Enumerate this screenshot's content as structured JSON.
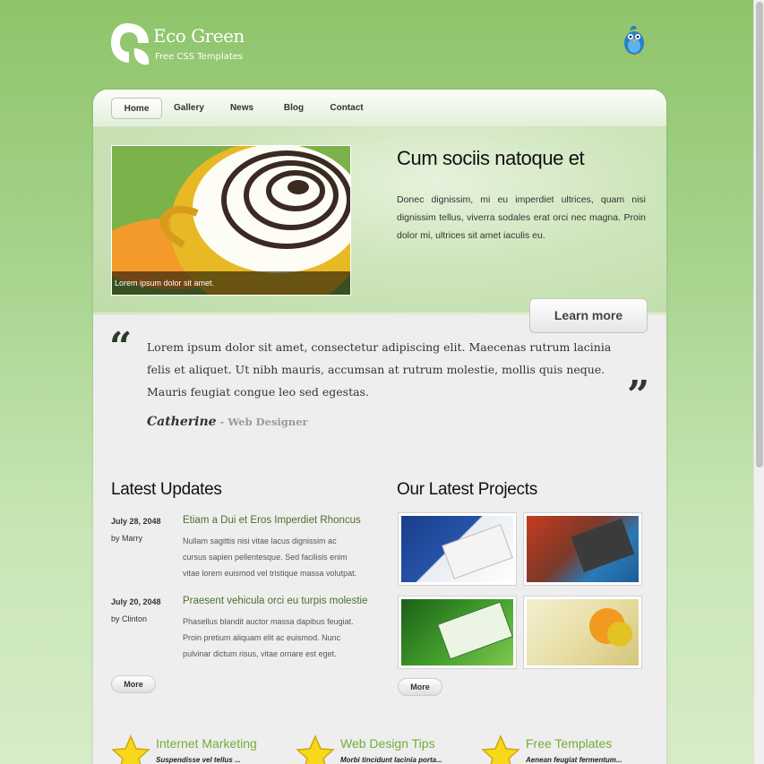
{
  "header": {
    "logo_title": "Eco Green",
    "logo_subtitle": "Free CSS Templates",
    "twitter_icon": "twitter-bird-icon"
  },
  "nav": {
    "items": [
      {
        "label": "Home",
        "active": true
      },
      {
        "label": "Gallery",
        "active": false
      },
      {
        "label": "News",
        "active": false
      },
      {
        "label": "Blog",
        "active": false
      },
      {
        "label": "Contact",
        "active": false
      }
    ]
  },
  "banner": {
    "photo_caption": "Lorem ipsum dolor sit amet.",
    "title": "Cum sociis natoque et",
    "text": "Donec dignissim, mi eu imperdiet ultrices, quam nisi dignissim tellus, viverra sodales erat orci nec magna. Proin dolor mi, ultrices sit amet iaculis eu.",
    "button_label": "Learn more"
  },
  "quote": {
    "open_mark": "“",
    "close_mark": "”",
    "text": "Lorem ipsum dolor sit amet, consectetur adipiscing elit. Maecenas rutrum lacinia felis et aliquet. Ut nibh mauris, accumsan at rutrum molestie, mollis quis neque. Mauris feugiat congue leo sed egestas.",
    "author": "Catherine",
    "separator": " - ",
    "role": "Web Designer"
  },
  "updates": {
    "title": "Latest Updates",
    "items": [
      {
        "date": "July 28, 2048",
        "by": "by Marry",
        "title": "Etiam a Dui et Eros Imperdiet Rhoncus",
        "body": "Nullam sagittis nisi vitae lacus dignissim ac cursus sapien pellentesque. Sed facilisis enim vitae lorem euismod vel tristique massa volutpat."
      },
      {
        "date": "July 20, 2048",
        "by": "by Clinton",
        "title": "Praesent vehicula orci eu turpis molestie",
        "body": "Phasellus blandit auctor massa dapibus feugiat. Proin pretium aliquam elit ac euismod. Nunc pulvinar dictum risus, vitae ornare est eget."
      }
    ],
    "more_label": "More"
  },
  "projects": {
    "title": "Our Latest Projects",
    "more_label": "More"
  },
  "features": [
    {
      "title": "Internet Marketing",
      "subtitle": "Suspendisse vel tellus ..."
    },
    {
      "title": "Web Design Tips",
      "subtitle": "Morbi tincidunt lacinia porta..."
    },
    {
      "title": "Free Templates",
      "subtitle": "Aenean feugiat fermentum..."
    }
  ],
  "colors": {
    "page_green": "#8ec46a",
    "link_green": "#72ad38",
    "update_title": "#4f6f2c"
  }
}
